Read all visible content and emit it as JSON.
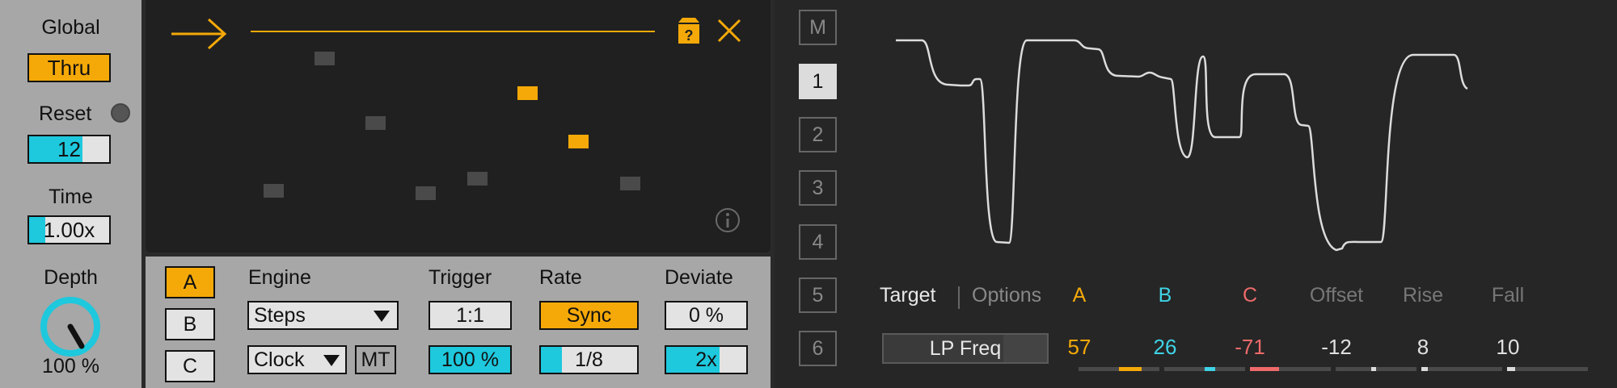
{
  "left": {
    "global_label": "Global",
    "thru_label": "Thru",
    "reset_label": "Reset",
    "reset_value": "12",
    "reset_fill": 0.67,
    "time_label": "Time",
    "time_value": "1.00x",
    "time_fill": 0.2,
    "depth_label": "Depth",
    "depth_value": "100 %",
    "depth_level": 1.0
  },
  "sequencer": {
    "info_icon": "info-icon",
    "help_icon": "question-box-icon",
    "close_icon": "close-icon",
    "arrow_icon": "arrow-right-icon",
    "active_color": "#f5a908"
  },
  "controls": {
    "var_a": "A",
    "var_b": "B",
    "var_c": "C",
    "engine_label": "Engine",
    "engine_value": "Steps",
    "clock_value": "Clock",
    "mt_label": "MT",
    "trigger_label": "Trigger",
    "trigger_value": "1:1",
    "trigger_pct": "100 %",
    "rate_label": "Rate",
    "rate_sync": "Sync",
    "rate_value": "1/8",
    "rate_fill": 0.22,
    "deviate_label": "Deviate",
    "deviate_value": "0 %",
    "deviate_mult": "2x",
    "deviate_fill": 0.67
  },
  "right": {
    "m_label": "M",
    "slots": [
      "1",
      "2",
      "3",
      "4",
      "5",
      "6"
    ],
    "selected_slot": "1",
    "target_tab": "Target",
    "options_tab": "Options",
    "target_value": "LP Freq",
    "mod_headers": [
      "A",
      "B",
      "C",
      "Offset",
      "Rise",
      "Fall"
    ],
    "mod_values": [
      "57",
      "26",
      "-71",
      "-12",
      "8",
      "10"
    ],
    "mod_fill": [
      0.57,
      0.26,
      -0.71,
      -0.12,
      0.08,
      0.1
    ],
    "colors": {
      "a": "#f5a908",
      "b": "#3fd3e6",
      "c": "#ef6a6a",
      "cyan": "#1ec8dd"
    }
  }
}
